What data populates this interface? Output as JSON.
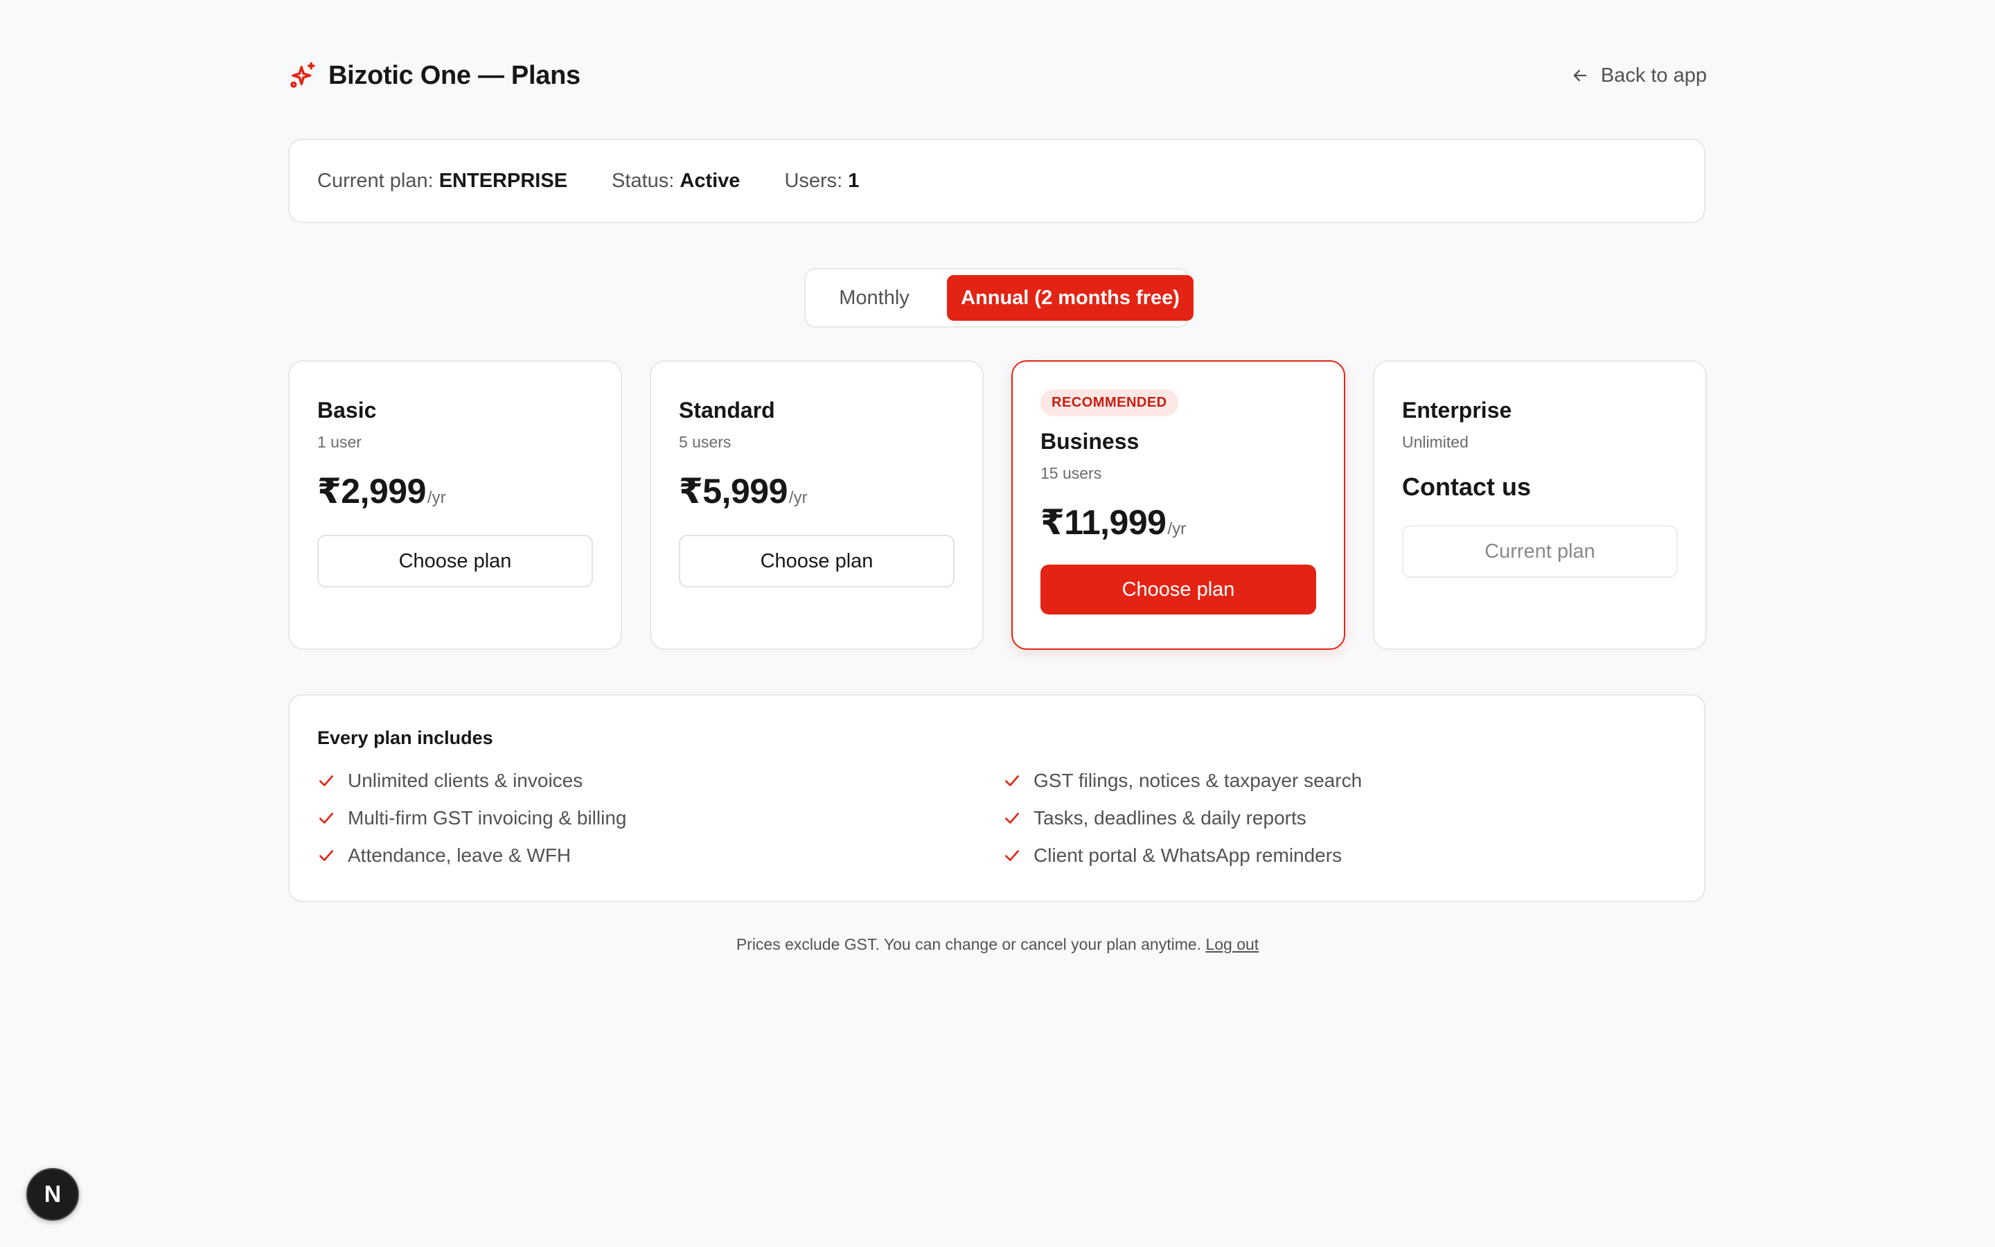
{
  "header": {
    "title": "Bizotic One — Plans",
    "back_label": "Back to app"
  },
  "current_plan": {
    "plan_label": "Current plan:",
    "plan_value": "ENTERPRISE",
    "status_label": "Status:",
    "status_value": "Active",
    "users_label": "Users:",
    "users_value": "1"
  },
  "billing_toggle": {
    "monthly": "Monthly",
    "annual": "Annual (2 months free)",
    "selected": "annual"
  },
  "plans": [
    {
      "name": "Basic",
      "users": "1 user",
      "price": "₹2,999",
      "period": "/yr",
      "button": "Choose plan"
    },
    {
      "name": "Standard",
      "users": "5 users",
      "price": "₹5,999",
      "period": "/yr",
      "button": "Choose plan"
    },
    {
      "badge": "RECOMMENDED",
      "name": "Business",
      "users": "15 users",
      "price": "₹11,999",
      "period": "/yr",
      "button": "Choose plan"
    },
    {
      "name": "Enterprise",
      "users": "Unlimited",
      "price_text": "Contact us",
      "button": "Current plan"
    }
  ],
  "includes": {
    "title": "Every plan includes",
    "features": [
      "Unlimited clients & invoices",
      "GST filings, notices & taxpayer search",
      "Multi-firm GST invoicing & billing",
      "Tasks, deadlines & daily reports",
      "Attendance, leave & WFH",
      "Client portal & WhatsApp reminders"
    ]
  },
  "footer": {
    "text": "Prices exclude GST. You can change or cancel your plan anytime.",
    "logout": "Log out"
  },
  "dev_badge": {
    "letter": "N"
  },
  "colors": {
    "accent": "#e32414",
    "background": "#f8f9fa"
  }
}
